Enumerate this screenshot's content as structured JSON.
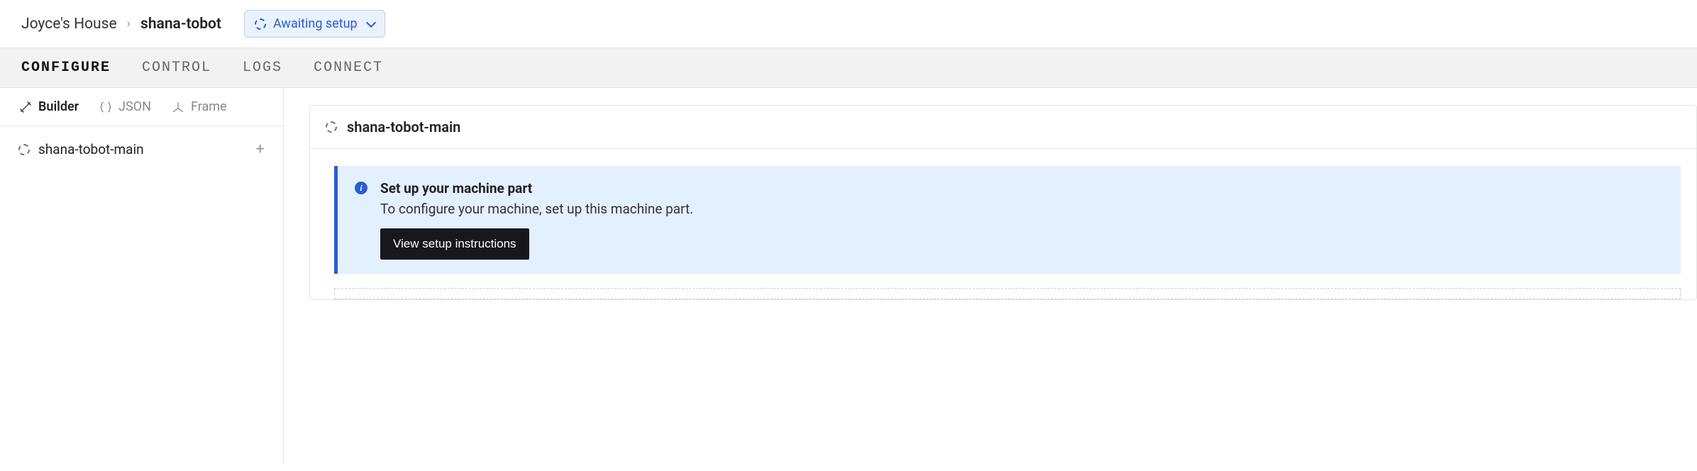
{
  "breadcrumb": {
    "parent": "Joyce's House",
    "current": "shana-tobot"
  },
  "status": {
    "label": "Awaiting setup"
  },
  "tabs": [
    {
      "label": "CONFIGURE",
      "active": true
    },
    {
      "label": "CONTROL",
      "active": false
    },
    {
      "label": "LOGS",
      "active": false
    },
    {
      "label": "CONNECT",
      "active": false
    }
  ],
  "sidebar_tabs": [
    {
      "label": "Builder",
      "active": true
    },
    {
      "label": "JSON",
      "active": false
    },
    {
      "label": "Frame",
      "active": false
    }
  ],
  "sidebar_items": [
    {
      "label": "shana-tobot-main"
    }
  ],
  "panel": {
    "title": "shana-tobot-main"
  },
  "info": {
    "title": "Set up your machine part",
    "description": "To configure your machine, set up this machine part.",
    "button": "View setup instructions"
  }
}
